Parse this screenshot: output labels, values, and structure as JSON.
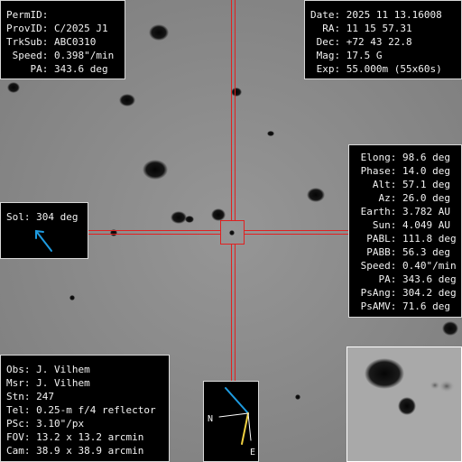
{
  "id_panel": {
    "rows": [
      "PermID:",
      "ProvID: C/2025 J1",
      "TrkSub: ABC0310",
      " Speed: 0.398\"/min",
      "    PA: 343.6 deg"
    ]
  },
  "date_panel": {
    "rows": [
      "Date: 2025 11 13.16008",
      "  RA: 11 15 57.31",
      " Dec: +72 43 22.8",
      " Mag: 17.5 G",
      " Exp: 55.000m (55x60s)"
    ]
  },
  "geo_panel": {
    "rows": [
      " Elong: 98.6 deg",
      " Phase: 14.0 deg",
      "   Alt: 57.1 deg",
      "    Az: 26.0 deg",
      " Earth: 3.782 AU",
      "   Sun: 4.049 AU",
      "  PABL: 111.8 deg",
      "  PABB: 56.3 deg",
      " Speed: 0.40\"/min",
      "    PA: 343.6 deg",
      " PsAng: 304.2 deg",
      " PsAMV: 71.6 deg"
    ]
  },
  "sol_panel": {
    "label": "Sol: 304 deg",
    "arrow_color": "#1e9be0"
  },
  "obs_panel": {
    "rows": [
      "Obs: J. Vilhem",
      "Msr: J. Vilhem",
      "Stn: 247",
      "Tel: 0.25-m f/4 reflector",
      "PSc: 3.10\"/px",
      "FOV: 13.2 x 13.2 arcmin",
      "Cam: 38.9 x 38.9 arcmin"
    ]
  },
  "compass": {
    "north_label": "N",
    "east_label": "E",
    "north_color": "#1e9be0",
    "east_color": "#f0d040"
  },
  "crosshair": {
    "color": "#e02020"
  }
}
